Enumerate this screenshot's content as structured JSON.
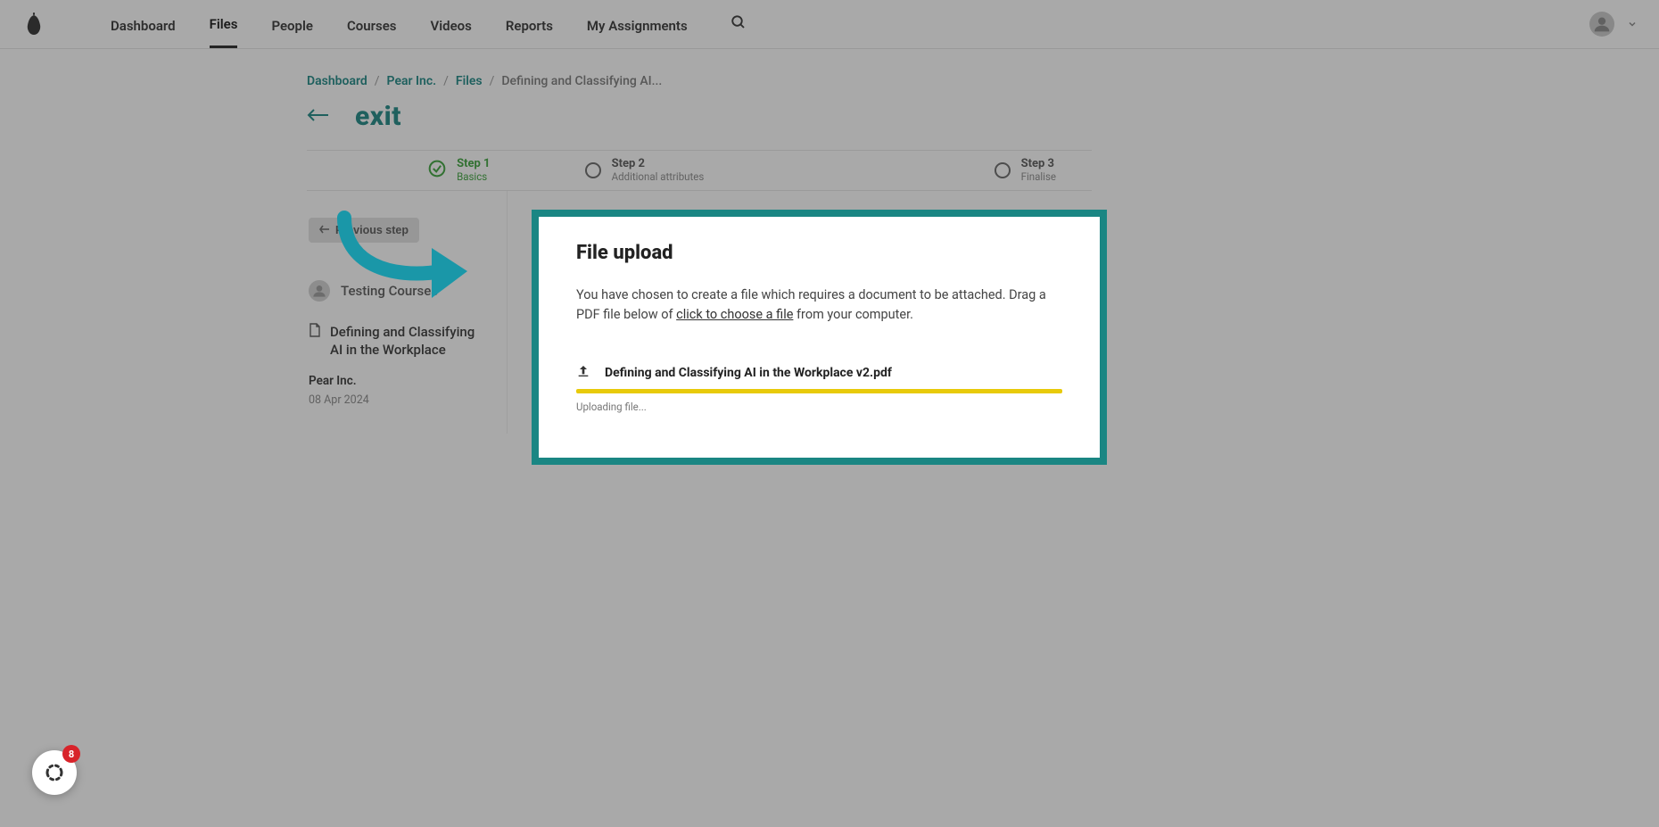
{
  "nav": {
    "items": [
      {
        "label": "Dashboard"
      },
      {
        "label": "Files"
      },
      {
        "label": "People"
      },
      {
        "label": "Courses"
      },
      {
        "label": "Videos"
      },
      {
        "label": "Reports"
      },
      {
        "label": "My Assignments"
      }
    ],
    "active_index": 1
  },
  "breadcrumb": {
    "items": [
      {
        "label": "Dashboard"
      },
      {
        "label": "Pear Inc."
      },
      {
        "label": "Files"
      }
    ],
    "current": "Defining and Classifying AI..."
  },
  "exit_label": "exit",
  "stepper": {
    "steps": [
      {
        "title": "Step 1",
        "sub": "Basics"
      },
      {
        "title": "Step 2",
        "sub": "Additional attributes"
      },
      {
        "title": "Step 3",
        "sub": "Finalise"
      }
    ],
    "active_index": 0
  },
  "left": {
    "prev_button": "Previous step",
    "author": "Testing Courses",
    "doc_title": "Defining and Classifying AI in the Workplace",
    "org": "Pear Inc.",
    "date": "08 Apr 2024"
  },
  "upload": {
    "heading": "File upload",
    "desc_pre": "You have chosen to create a file which requires a document to be attached. Drag a PDF file below of ",
    "desc_link": "click to choose a file",
    "desc_post": " from your computer.",
    "filename": "Defining and Classifying AI in the Workplace v2.pdf",
    "status": "Uploading file...",
    "progress_percent": 100
  },
  "chat": {
    "badge_count": "8"
  },
  "colors": {
    "accent": "#1a8683",
    "success": "#3aa23a",
    "progress": "#e8ca0a",
    "badge": "#d8232a"
  }
}
